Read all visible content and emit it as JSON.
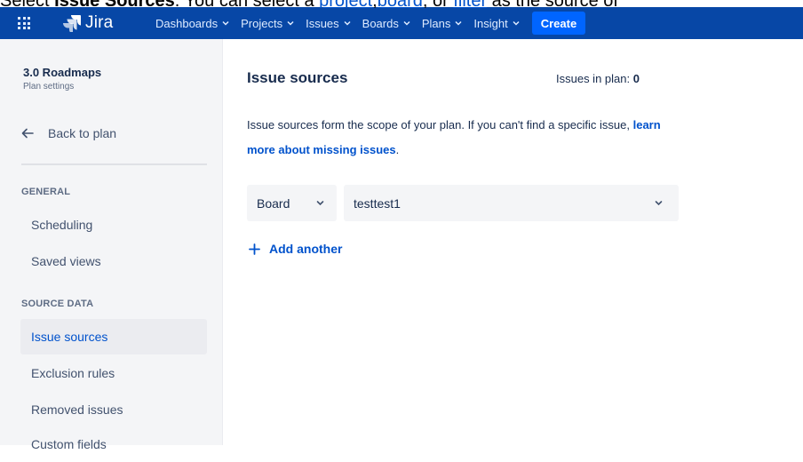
{
  "instruction": {
    "lead": "Select ",
    "bold": "Issue Sources",
    "middle": ". You can select a ",
    "link_project": "project",
    "comma1": ",",
    "link_board": "board",
    "comma2": ", or ",
    "link_filter": "filter",
    "tail": " as the source of"
  },
  "navbar": {
    "logo_text": "Jira",
    "items": [
      {
        "label": "Dashboards"
      },
      {
        "label": "Projects"
      },
      {
        "label": "Issues"
      },
      {
        "label": "Boards"
      },
      {
        "label": "Plans"
      },
      {
        "label": "Insight"
      }
    ],
    "create_label": "Create",
    "colors": {
      "bar": "#0747a6",
      "create": "#0065ff"
    }
  },
  "sidebar": {
    "plan_title": "3.0 Roadmaps",
    "plan_subtitle": "Plan settings",
    "back_label": "Back to plan",
    "general_heading": "GENERAL",
    "general_items": [
      {
        "label": "Scheduling"
      },
      {
        "label": "Saved views"
      }
    ],
    "source_heading": "SOURCE DATA",
    "source_items": [
      {
        "label": "Issue sources",
        "active": true
      },
      {
        "label": "Exclusion rules"
      },
      {
        "label": "Removed issues"
      },
      {
        "label": "Custom fields"
      }
    ]
  },
  "main": {
    "title": "Issue sources",
    "issues_in_plan_label": "Issues in plan:",
    "issues_in_plan_count": "0",
    "description": "Issue sources form the scope of your plan. If you can't find a specific issue,",
    "learn_more_link": "learn more about missing issues",
    "description_end": ".",
    "source_type": "Board",
    "source_value": "testtest1",
    "add_another_label": "Add another"
  }
}
